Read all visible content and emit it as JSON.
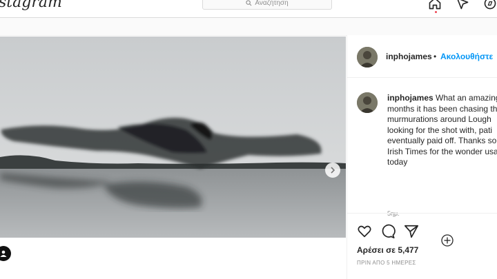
{
  "topbar": {
    "logo_text": "stagram",
    "search_placeholder": "Αναζήτηση",
    "icons": [
      "home-icon",
      "explore-icon",
      "activity-icon"
    ]
  },
  "post": {
    "username": "inphojames",
    "separator": "•",
    "follow_label": "Ακολουθήστε",
    "caption_user": "inphojames",
    "caption_text": "What an amazing months it has been chasing the murmurations around Lough looking for the shot with, pati eventually paid off. Thanks so the Irish Times for the wonder usage today",
    "caption_time": "5ημ.",
    "likes_label": "Αρέσει σε 5,477",
    "posted_ago": "ΠΡΙΝ ΑΠΟ 5 ΗΜΕΡΕΣ",
    "carousel_pages": 2,
    "carousel_active": 1
  },
  "colors": {
    "accent": "#0095f6",
    "notification": "#ed4956"
  }
}
